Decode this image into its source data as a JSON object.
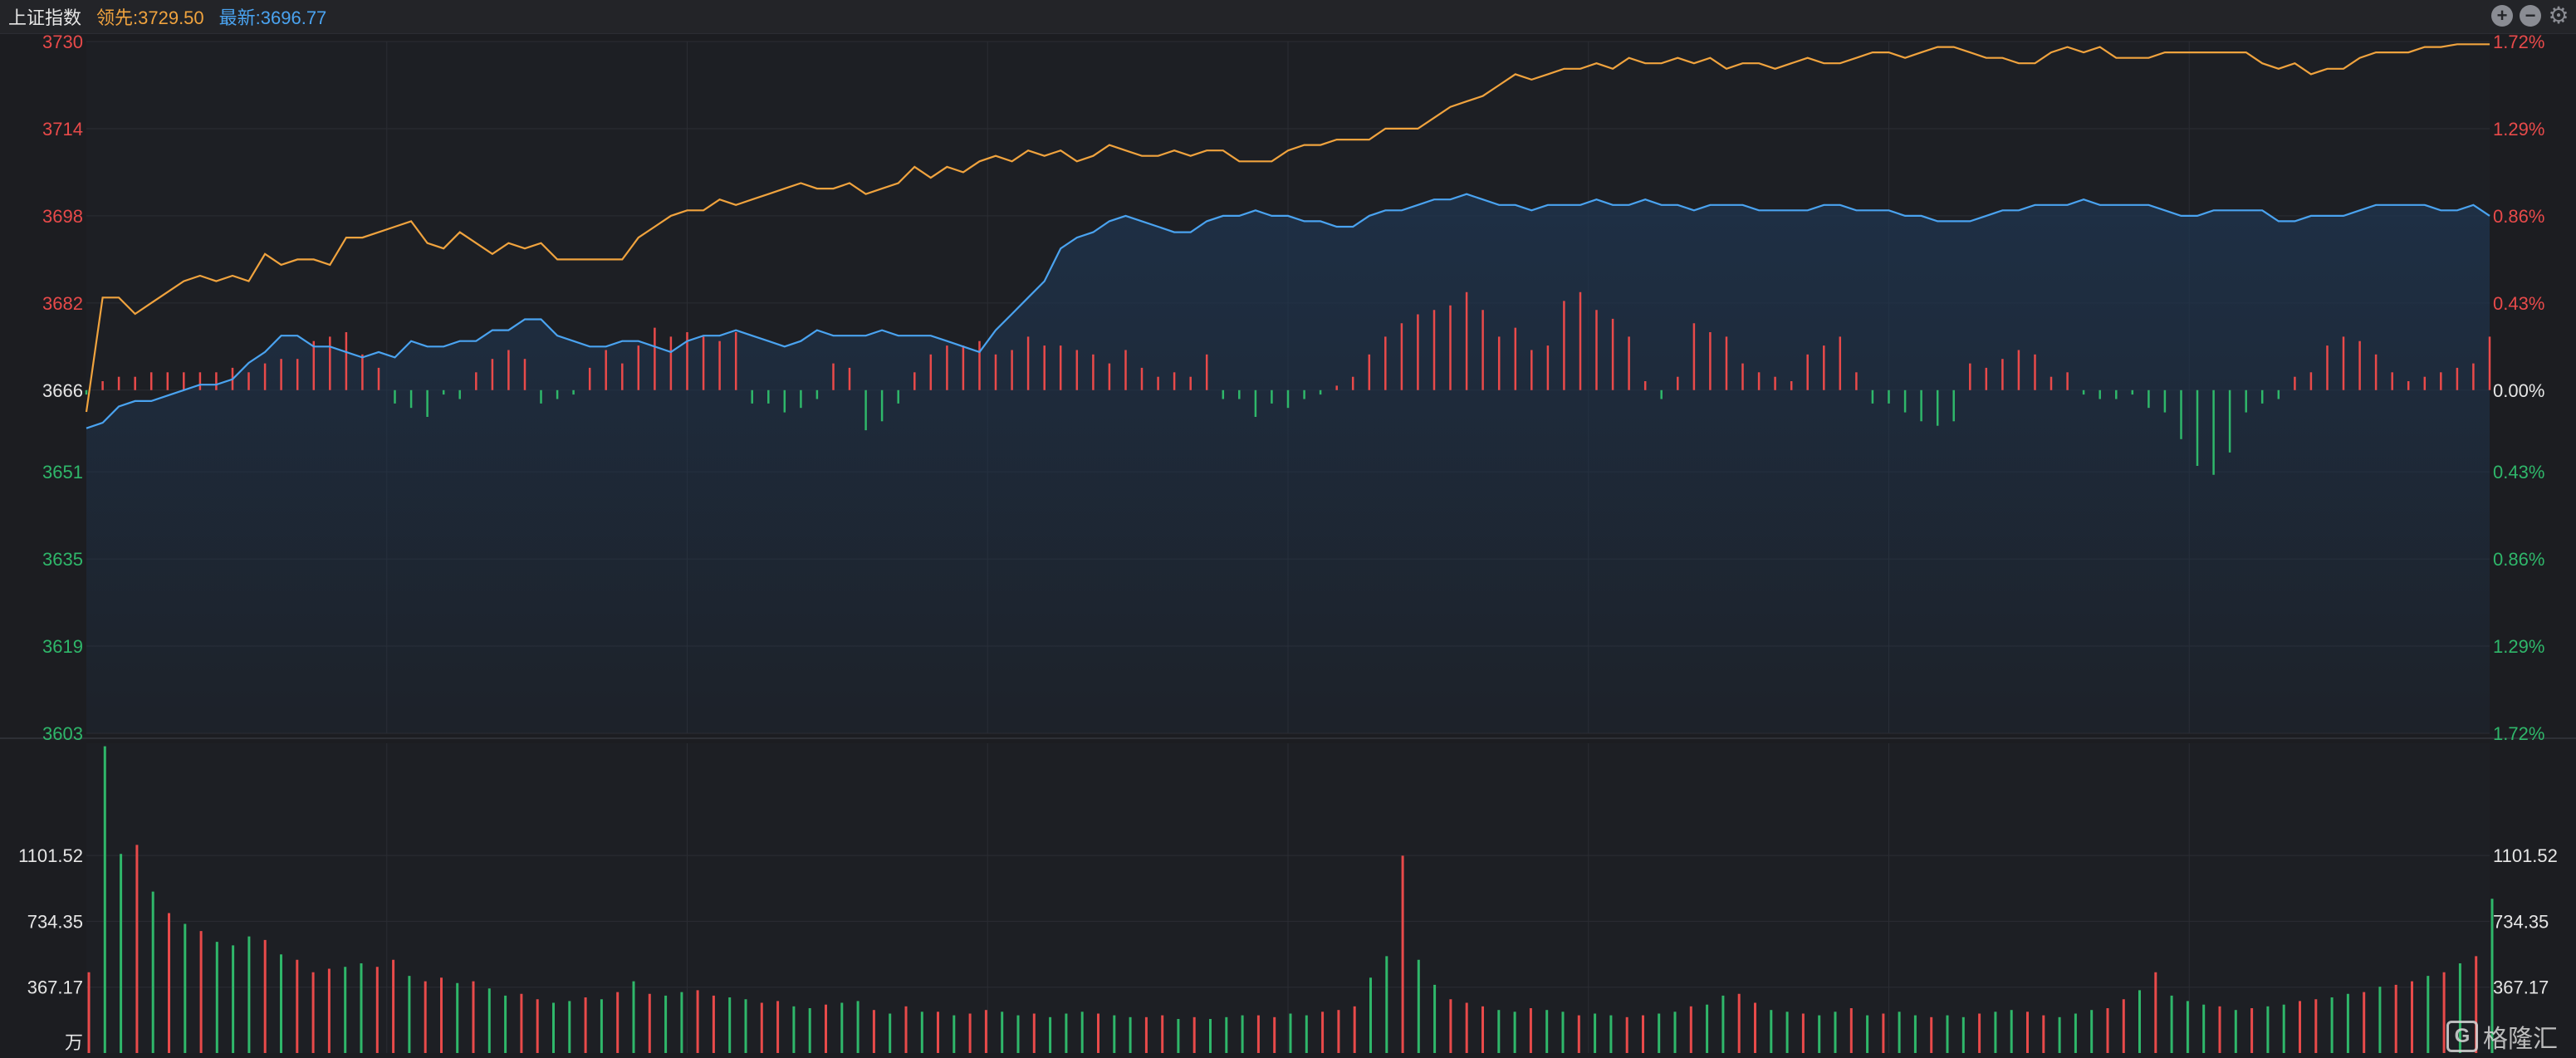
{
  "header": {
    "index_name": "上证指数",
    "leading_label": "领先:3729.50",
    "latest_label": "最新:3696.77",
    "controls": [
      "zoom-in-icon",
      "zoom-out-icon",
      "gear-icon"
    ]
  },
  "colors": {
    "up": "#e84a4a",
    "down": "#2fb76a",
    "leading_line": "#f0a33e",
    "latest_line": "#4aa3f0",
    "grid": "#2b2d33",
    "area_fill": "#1e3550"
  },
  "watermark": {
    "text": "格隆汇",
    "logo": "G"
  },
  "chart_data": [
    {
      "type": "line",
      "title": "上证指数",
      "prev_close": 3666,
      "ylim": [
        3603,
        3730
      ],
      "left_ticks": [
        "3730",
        "3714",
        "3698",
        "3682",
        "3666",
        "3651",
        "3635",
        "3619",
        "3603"
      ],
      "right_ticks": [
        "1.72%",
        "1.29%",
        "0.86%",
        "0.43%",
        "0.00%",
        "0.43%",
        "0.86%",
        "1.29%",
        "1.72%"
      ],
      "tick_colors": [
        "up",
        "up",
        "up",
        "up",
        "neutral",
        "down",
        "down",
        "down",
        "down"
      ],
      "series": [
        {
          "name": "领先",
          "values": [
            3662,
            3683,
            3683,
            3680,
            3682,
            3684,
            3686,
            3687,
            3686,
            3687,
            3686,
            3691,
            3689,
            3690,
            3690,
            3689,
            3694,
            3694,
            3695,
            3696,
            3697,
            3693,
            3692,
            3695,
            3693,
            3691,
            3693,
            3692,
            3693,
            3690,
            3690,
            3690,
            3690,
            3690,
            3694,
            3696,
            3698,
            3699,
            3699,
            3701,
            3700,
            3701,
            3702,
            3703,
            3704,
            3703,
            3703,
            3704,
            3702,
            3703,
            3704,
            3707,
            3705,
            3707,
            3706,
            3708,
            3709,
            3708,
            3710,
            3709,
            3710,
            3708,
            3709,
            3711,
            3710,
            3709,
            3709,
            3710,
            3709,
            3710,
            3710,
            3708,
            3708,
            3708,
            3710,
            3711,
            3711,
            3712,
            3712,
            3712,
            3714,
            3714,
            3714,
            3716,
            3718,
            3719,
            3720,
            3722,
            3724,
            3723,
            3724,
            3725,
            3725,
            3726,
            3725,
            3727,
            3726,
            3726,
            3727,
            3726,
            3727,
            3725,
            3726,
            3726,
            3725,
            3726,
            3727,
            3726,
            3726,
            3727,
            3728,
            3728,
            3727,
            3728,
            3729,
            3729,
            3728,
            3727,
            3727,
            3726,
            3726,
            3728,
            3729,
            3728,
            3729,
            3727,
            3727,
            3727,
            3728,
            3728,
            3728,
            3728,
            3728,
            3728,
            3726,
            3725,
            3726,
            3724,
            3725,
            3725,
            3727,
            3728,
            3728,
            3728,
            3729,
            3729,
            3729.5,
            3729.5,
            3729.5
          ]
        },
        {
          "name": "最新",
          "values": [
            3659,
            3660,
            3663,
            3664,
            3664,
            3665,
            3666,
            3667,
            3667,
            3668,
            3671,
            3673,
            3676,
            3676,
            3674,
            3674,
            3673,
            3672,
            3673,
            3672,
            3675,
            3674,
            3674,
            3675,
            3675,
            3677,
            3677,
            3679,
            3679,
            3676,
            3675,
            3674,
            3674,
            3675,
            3675,
            3674,
            3673,
            3675,
            3676,
            3676,
            3677,
            3676,
            3675,
            3674,
            3675,
            3677,
            3676,
            3676,
            3676,
            3677,
            3676,
            3676,
            3676,
            3675,
            3674,
            3673,
            3677,
            3680,
            3683,
            3686,
            3692,
            3694,
            3695,
            3697,
            3698,
            3697,
            3696,
            3695,
            3695,
            3697,
            3698,
            3698,
            3699,
            3698,
            3698,
            3697,
            3697,
            3696,
            3696,
            3698,
            3699,
            3699,
            3700,
            3701,
            3701,
            3702,
            3701,
            3700,
            3700,
            3699,
            3700,
            3700,
            3700,
            3701,
            3700,
            3700,
            3701,
            3700,
            3700,
            3699,
            3700,
            3700,
            3700,
            3699,
            3699,
            3699,
            3699,
            3700,
            3700,
            3699,
            3699,
            3699,
            3698,
            3698,
            3697,
            3697,
            3697,
            3698,
            3699,
            3699,
            3700,
            3700,
            3700,
            3701,
            3700,
            3700,
            3700,
            3700,
            3699,
            3698,
            3698,
            3699,
            3699,
            3699,
            3699,
            3697,
            3697,
            3698,
            3698,
            3698,
            3699,
            3700,
            3700,
            3700,
            3700,
            3699,
            3699,
            3700,
            3698
          ]
        }
      ],
      "breadth_bars": {
        "values": [
          -1,
          2,
          3,
          3,
          4,
          4,
          4,
          4,
          4,
          5,
          4,
          6,
          7,
          7,
          11,
          12,
          13,
          8,
          5,
          -3,
          -4,
          -6,
          -1,
          -2,
          4,
          7,
          9,
          7,
          -3,
          -2,
          -1,
          5,
          9,
          6,
          10,
          14,
          12,
          13,
          12,
          11,
          13,
          -3,
          -3,
          -5,
          -4,
          -2,
          6,
          5,
          -9,
          -7,
          -3,
          4,
          8,
          10,
          10,
          11,
          8,
          9,
          12,
          10,
          10,
          9,
          8,
          6,
          9,
          5,
          3,
          4,
          3,
          8,
          -2,
          -2,
          -6,
          -3,
          -4,
          -2,
          -1,
          1,
          3,
          8,
          12,
          15,
          17,
          18,
          19,
          22,
          18,
          12,
          14,
          9,
          10,
          20,
          22,
          18,
          16,
          12,
          2,
          -2,
          3,
          15,
          13,
          12,
          6,
          4,
          3,
          2,
          8,
          10,
          12,
          4,
          -3,
          -3,
          -5,
          -7,
          -8,
          -7,
          6,
          5,
          7,
          9,
          8,
          3,
          4,
          -1,
          -2,
          -2,
          -1,
          -4,
          -5,
          -11,
          -17,
          -19,
          -14,
          -5,
          -3,
          -2,
          3,
          4,
          10,
          12,
          11,
          8,
          4,
          2,
          3,
          4,
          5,
          6,
          12
        ],
        "scale_max": 22
      },
      "volume_bars": {
        "unit_label": "万",
        "ylim": [
          0,
          1750
        ],
        "left_ticks": [
          "1101.52",
          "734.35",
          "367.17"
        ],
        "right_ticks": [
          "1101.52",
          "734.35",
          "367.17"
        ],
        "values": [
          450,
          1710,
          1110,
          1160,
          900,
          780,
          720,
          680,
          620,
          600,
          650,
          630,
          550,
          520,
          450,
          470,
          480,
          500,
          480,
          520,
          430,
          400,
          420,
          390,
          400,
          360,
          320,
          330,
          300,
          280,
          290,
          310,
          300,
          340,
          400,
          330,
          320,
          340,
          350,
          320,
          310,
          300,
          280,
          290,
          260,
          250,
          270,
          280,
          290,
          240,
          220,
          260,
          230,
          230,
          210,
          220,
          240,
          230,
          210,
          220,
          200,
          220,
          230,
          220,
          210,
          200,
          200,
          210,
          190,
          200,
          190,
          200,
          210,
          210,
          200,
          220,
          210,
          230,
          240,
          260,
          420,
          540,
          1100,
          520,
          380,
          300,
          280,
          260,
          240,
          230,
          250,
          240,
          230,
          210,
          220,
          210,
          200,
          210,
          220,
          230,
          260,
          270,
          320,
          330,
          280,
          240,
          230,
          220,
          210,
          230,
          250,
          210,
          220,
          230,
          210,
          200,
          210,
          200,
          220,
          230,
          240,
          230,
          210,
          200,
          220,
          240,
          250,
          300,
          350,
          450,
          320,
          290,
          270,
          260,
          240,
          250,
          260,
          270,
          290,
          300,
          310,
          330,
          340,
          370,
          380,
          400,
          430,
          450,
          500,
          540,
          860
        ],
        "colors": "uddudududdduduuudduuduududduuddudududduudduudduddudududuuddudddudduududdduudduuuddudduuudduddudduuddudduudduddududduddudduuddduududddududduudduduudududd"
      }
    }
  ]
}
